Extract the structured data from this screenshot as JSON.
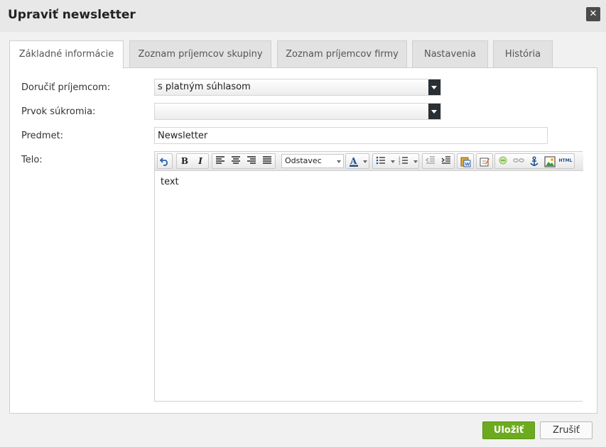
{
  "dialog": {
    "title": "Upraviť newsletter"
  },
  "tabs": [
    {
      "label": "Základné informácie",
      "active": true
    },
    {
      "label": "Zoznam príjemcov skupiny",
      "active": false
    },
    {
      "label": "Zoznam príjemcov firmy",
      "active": false
    },
    {
      "label": "Nastavenia",
      "active": false
    },
    {
      "label": "História",
      "active": false
    }
  ],
  "form": {
    "recipients": {
      "label": "Doručiť príjemcom:",
      "value": "s platným súhlasom"
    },
    "privacy": {
      "label": "Prvok súkromia:",
      "value": ""
    },
    "subject": {
      "label": "Predmet:",
      "value": "Newsletter"
    },
    "body": {
      "label": "Telo:",
      "content": "text"
    }
  },
  "editor": {
    "format_value": "Odstavec",
    "html_label": "HTML",
    "toolbar_icons": [
      "undo-icon",
      "bold-icon",
      "italic-icon",
      "align-left-icon",
      "align-center-icon",
      "align-right-icon",
      "align-justify-icon",
      "font-color-icon",
      "bullet-list-icon",
      "numbered-list-icon",
      "outdent-icon",
      "indent-icon",
      "paste-word-icon",
      "edit-icon",
      "link-icon",
      "unlink-icon",
      "anchor-icon",
      "image-icon",
      "html-source-icon"
    ]
  },
  "actions": {
    "save_label": "Uložiť",
    "cancel_label": "Zrušiť"
  },
  "colors": {
    "accent": "#6cab1f",
    "close_bg": "#4a4a4a",
    "select_arrow_bg": "#2a2f33"
  }
}
